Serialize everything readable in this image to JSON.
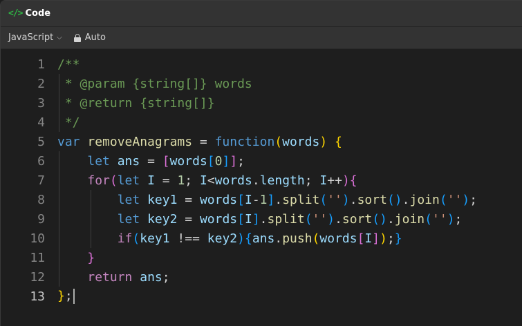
{
  "titlebar": {
    "icon": "code-brackets-icon",
    "icon_glyph": "</>",
    "title": "Code"
  },
  "toolbar": {
    "language": "JavaScript",
    "mode": "Auto",
    "chevron": "⌵"
  },
  "editor": {
    "active_line": 13,
    "lines": [
      {
        "num": "1"
      },
      {
        "num": "2"
      },
      {
        "num": "3"
      },
      {
        "num": "4"
      },
      {
        "num": "5"
      },
      {
        "num": "6"
      },
      {
        "num": "7"
      },
      {
        "num": "8"
      },
      {
        "num": "9"
      },
      {
        "num": "10"
      },
      {
        "num": "11"
      },
      {
        "num": "12"
      },
      {
        "num": "13"
      }
    ],
    "text": {
      "l1": "/**",
      "l2": " * @param {string[]} words",
      "l3": " * @return {string[]}",
      "l4": " */",
      "var": "var",
      "fnname": "removeAnagrams",
      "function": "function",
      "words": "words",
      "let": "let",
      "ans": "ans",
      "zero": "0",
      "for": "for",
      "I": "I",
      "one": "1",
      "length": "length",
      "key1": "key1",
      "key2": "key2",
      "split": "split",
      "sort": "sort",
      "join": "join",
      "emptystr": "''",
      "if": "if",
      "push": "push",
      "return": "return"
    }
  },
  "colors": {
    "background": "#1e1e1e",
    "header": "#333333",
    "keyword": "#569cd6",
    "control": "#c586c0",
    "variable": "#9cdcfe",
    "function": "#dcdcaa",
    "string": "#ce9178",
    "number": "#b5cea8",
    "comment": "#6a9955",
    "accent_icon": "#2fb344"
  }
}
